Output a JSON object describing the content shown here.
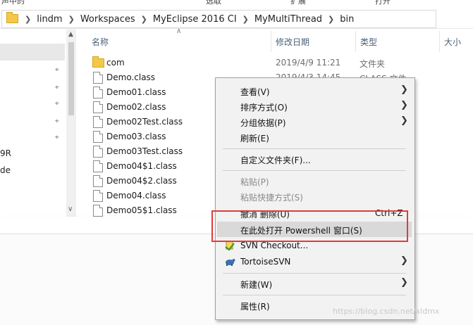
{
  "ribbon": {
    "left_text": "声中的",
    "mid_text": "选取",
    "right1": "扩展",
    "right2": "打开"
  },
  "address": {
    "crumbs": [
      "lindm",
      "Workspaces",
      "MyEclipse 2016 CI",
      "MyMultiThread",
      "bin"
    ]
  },
  "nav": {
    "items": [
      "9R",
      "de"
    ]
  },
  "columns": {
    "name": "名称",
    "modified": "修改日期",
    "type": "类型",
    "size": "大小"
  },
  "files": [
    {
      "name": "com",
      "date": "2019/4/9 11:21",
      "type": "文件夹",
      "kind": "folder"
    },
    {
      "name": "Demo.class",
      "date": "2019/4/3 14:45",
      "type": "CLASS 文件",
      "kind": "file"
    },
    {
      "name": "Demo01.class",
      "date": "",
      "type": "",
      "kind": "file"
    },
    {
      "name": "Demo02.class",
      "date": "",
      "type": "",
      "kind": "file"
    },
    {
      "name": "Demo02Test.class",
      "date": "",
      "type": "",
      "kind": "file"
    },
    {
      "name": "Demo03.class",
      "date": "",
      "type": "",
      "kind": "file"
    },
    {
      "name": "Demo03Test.class",
      "date": "",
      "type": "",
      "kind": "file"
    },
    {
      "name": "Demo04$1.class",
      "date": "",
      "type": "",
      "kind": "file"
    },
    {
      "name": "Demo04$2.class",
      "date": "",
      "type": "",
      "kind": "file"
    },
    {
      "name": "Demo04.class",
      "date": "",
      "type": "",
      "kind": "file"
    },
    {
      "name": "Demo05$1.class",
      "date": "",
      "type": "",
      "kind": "file"
    }
  ],
  "context_menu": {
    "view": "查看(V)",
    "sort": "排序方式(O)",
    "group": "分组依据(P)",
    "refresh": "刷新(E)",
    "customize": "自定义文件夹(F)...",
    "paste": "粘贴(P)",
    "paste_shortcut": "粘贴快捷方式(S)",
    "undo_delete": "撤消 删除(U)",
    "undo_shortcut": "Ctrl+Z",
    "powershell": "在此处打开 Powershell 窗口(S)",
    "svn_checkout": "SVN Checkout...",
    "tortoise": "TortoiseSVN",
    "new": "新建(W)",
    "properties": "属性(R)"
  },
  "colors": {
    "highlight": "#d9d9d9",
    "annotation": "#e23a3a",
    "menu_bg": "#f2f2f2"
  },
  "watermark": "https://blog.csdn.net/xldmx"
}
